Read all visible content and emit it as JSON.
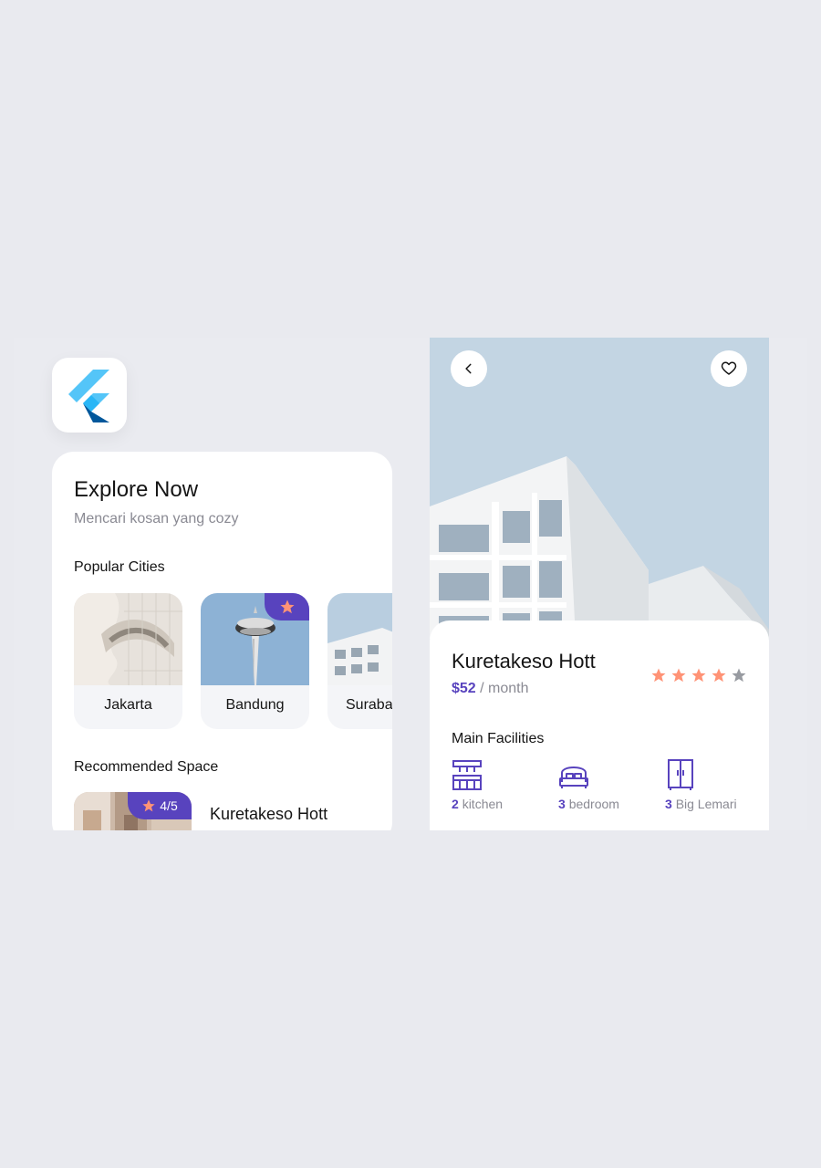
{
  "colors": {
    "primary": "#5843be",
    "star_active": "#ff9376",
    "star_inactive": "#989ba1",
    "text": "#151515",
    "muted": "#8a8a93"
  },
  "app": {
    "logo": "flutter-logo"
  },
  "explore": {
    "title": "Explore Now",
    "subtitle": "Mencari kosan yang cozy",
    "popular_title": "Popular Cities",
    "cities": [
      {
        "name": "Jakarta"
      },
      {
        "name": "Bandung",
        "favorite_icon": "star-icon"
      },
      {
        "name": "Surabaya"
      }
    ],
    "recommended_title": "Recommended Space",
    "recommended": {
      "name": "Kuretakeso Hott",
      "rating": "4/5"
    }
  },
  "detail": {
    "back_icon": "chevron-left-icon",
    "favorite_icon": "heart-icon",
    "name": "Kuretakeso Hott",
    "price": "$52",
    "price_unit": "/ month",
    "rating": 4,
    "rating_max": 5,
    "facilities_title": "Main Facilities",
    "facilities": [
      {
        "count": "2",
        "label": "kitchen",
        "icon": "kitchen-icon"
      },
      {
        "count": "3",
        "label": "bedroom",
        "icon": "bed-icon"
      },
      {
        "count": "3",
        "label": "Big Lemari",
        "icon": "wardrobe-icon"
      }
    ]
  }
}
